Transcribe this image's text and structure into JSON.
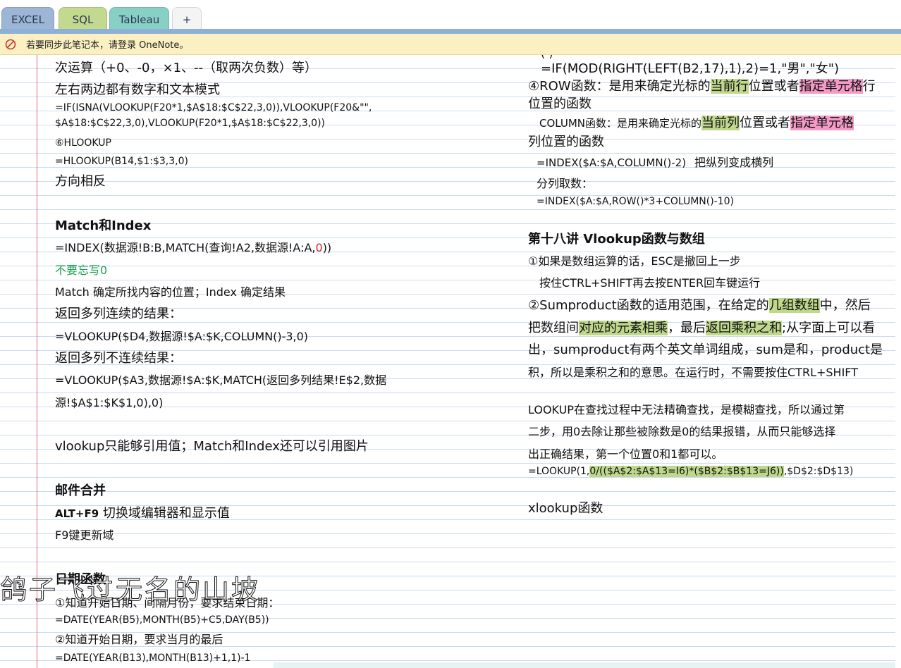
{
  "tabs": [
    "EXCEL",
    "SQL",
    "Tableau"
  ],
  "tab_add": "+",
  "notice": "若要同步此笔记本，请登录 OneNote。",
  "left": {
    "l1": "次运算（+0、-0，×1、--（取两次负数）等）",
    "l2": "左右两边都有数字和文本模式",
    "l3": "=IF(ISNA(VLOOKUP(F20*1,$A$18:$C$22,3,0)),VLOOKUP(F20&\"\",",
    "l4": "$A$18:$C$22,3,0),VLOOKUP(F20*1,$A$18:$C$22,3,0))",
    "l5": "⑥HLOOKUP",
    "l6": "=HLOOKUP(B14,$1:$3,3,0)",
    "l7": "方向相反",
    "h_match": "Match和Index",
    "idx_a": "=INDEX(数据源!B:B,MATCH(查询!A2,数据源!A:A,",
    "idx_b": "0",
    "idx_c": "))",
    "dontforget": "不要忘写0",
    "match_desc": "Match 确定所找内容的位置；Index 确定结果",
    "ret_cont": "返回多列连续的结果：",
    "vl_cont": "=VLOOKUP($D4,数据源!$A:$K,COLUMN()-3,0)",
    "ret_noncont": "返回多列不连续结果：",
    "vl_nc1": "=VLOOKUP($A3,数据源!$A:$K,MATCH(返回多列结果!E$2,数据",
    "vl_nc2": "源!$A$1:$K$1,0),0)",
    "vlookup_note": "vlookup只能够引用值；Match和Index还可以引用图片",
    "h_mail": "邮件合并",
    "alt_key": "ALT+F9",
    "alt_desc": " 切换域编辑器和显示值",
    "f9": "F9键更新域",
    "h_date": "日期函数",
    "d1": "①知道开始日期、间隔月份，要求结束日期：",
    "d2": "=DATE(YEAR(B5),MONTH(B5)+C5,DAY(B5))",
    "d3": "②知道开始日期，要求当月的最后",
    "d4": "=DATE(YEAR(B13),MONTH(B13)+1,1)-1"
  },
  "right": {
    "top_partial": "(      )",
    "sex": "=IF(MOD(RIGHT(LEFT(B2,17),1),2)=1,\"男\",\"女\")",
    "row_a": "④ROW函数：是用来确定光标的",
    "row_b": "当前行",
    "row_c": "位置或者",
    "row_d": "指定单元格",
    "row_e": "行",
    "row_f": "位置的函数",
    "col_a": "COLUMN函数：是用来确定光标的",
    "col_b": "当前列",
    "col_c": "位置或者",
    "col_d": "指定单元格",
    "col_e": "列位置的函数",
    "idx1_f": "=INDEX($A:$A,COLUMN()-2)",
    "idx1_t": "把纵列变成横列",
    "split": "分列取数：",
    "idx2": "=INDEX($A:$A,ROW()*3+COLUMN()-10)",
    "h18": "第十八讲 Vlookup函数与数组",
    "arr1": "①如果是数组运算的话，ESC是撤回上一步",
    "arr2": "按住CTRL+SHIFT再去按ENTER回车键运行",
    "sp1a": "②Sumproduct函数的适用范围，在给定的",
    "sp1b": "几组数组",
    "sp1c": "中，然后",
    "sp2a": "把数组间",
    "sp2b": "对应的元素相乘",
    "sp2c": "，最后",
    "sp2d": "返回乘积之和",
    "sp2e": ";从字面上可以看",
    "sp3": "出，sumproduct有两个英文单词组成，sum是和，product是",
    "sp4": "积，所以是乘积之和的意思。在运行时，不需要按住CTRL+SHIFT",
    "lk1": "LOOKUP在查找过程中无法精确查找，是模糊查找，所以通过第",
    "lk2": "二步，用0去除让那些被除数是0的结果报错，从而只能够选择",
    "lk3": "出正确结果，第一个位置0和1都可以。",
    "lkf_a": "=LOOKUP(1,",
    "lkf_b": "0/(($A$2:$A$13=I6)*($B$2:$B$13=J6))",
    "lkf_c": ",$D$2:$D$13)",
    "xlookup": "xlookup函数"
  },
  "watermark": "鸽子飞过无名的山坡"
}
